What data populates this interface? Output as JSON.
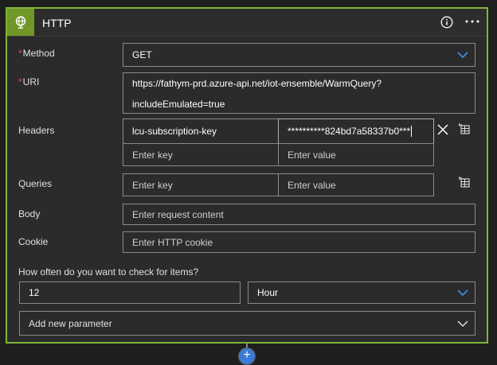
{
  "header": {
    "title": "HTTP",
    "info_icon": "info-icon",
    "more_icon": "more-icon",
    "action_icon": "globe-icon"
  },
  "method": {
    "label": "Method",
    "required_mark": "*",
    "value": "GET"
  },
  "uri": {
    "label": "URI",
    "required_mark": "*",
    "line1": "https://fathym-prd.azure-api.net/iot-ensemble/WarmQuery?",
    "line2": "includeEmulated=true"
  },
  "headers": {
    "label": "Headers",
    "rows": [
      {
        "key": "lcu-subscription-key",
        "value": "**********824bd7a58337b0***"
      }
    ],
    "key_placeholder": "Enter key",
    "value_placeholder": "Enter value"
  },
  "queries": {
    "label": "Queries",
    "key_placeholder": "Enter key",
    "value_placeholder": "Enter value"
  },
  "body": {
    "label": "Body",
    "placeholder": "Enter request content"
  },
  "cookie": {
    "label": "Cookie",
    "placeholder": "Enter HTTP cookie"
  },
  "recurrence": {
    "question": "How often do you want to check for items?",
    "interval": "12",
    "frequency": "Hour"
  },
  "add_param": {
    "label": "Add new parameter"
  },
  "colors": {
    "accent": "#7eb539",
    "header_icon_bg": "#709727",
    "required": "#e74856",
    "dropdown_chevron": "#3a8ee6"
  }
}
